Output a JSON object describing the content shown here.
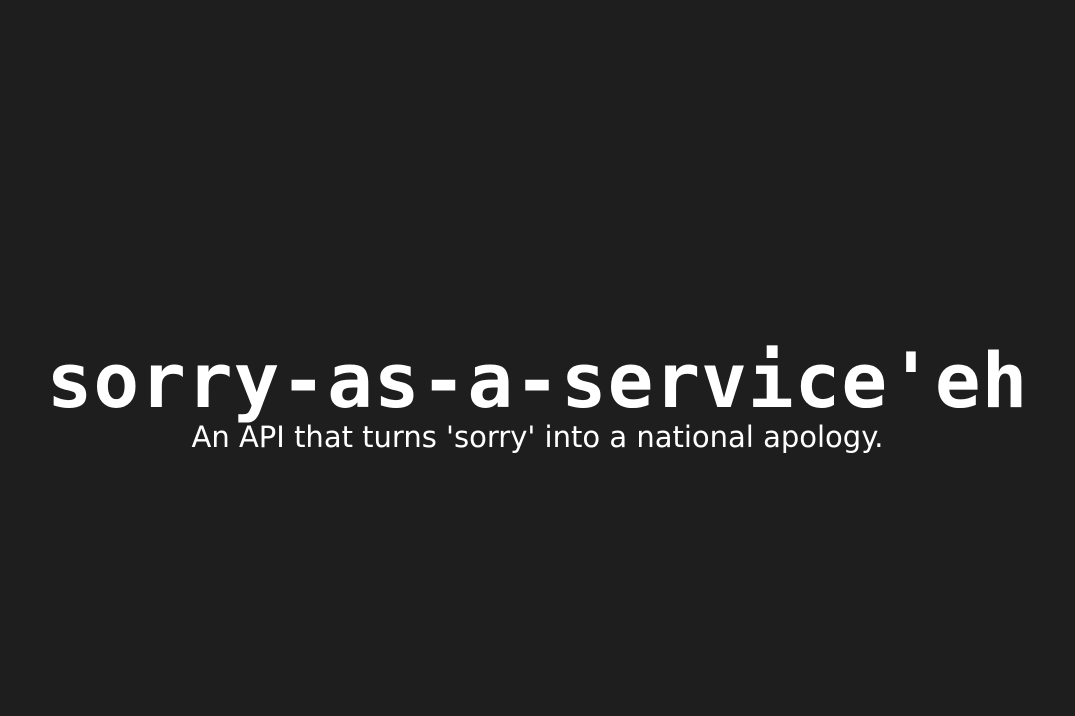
{
  "hero": {
    "title": "sorry-as-a-service'eh",
    "subtitle": "An API that turns 'sorry' into a national apology."
  },
  "colors": {
    "background": "#1e1e1e",
    "text": "#ffffff"
  }
}
